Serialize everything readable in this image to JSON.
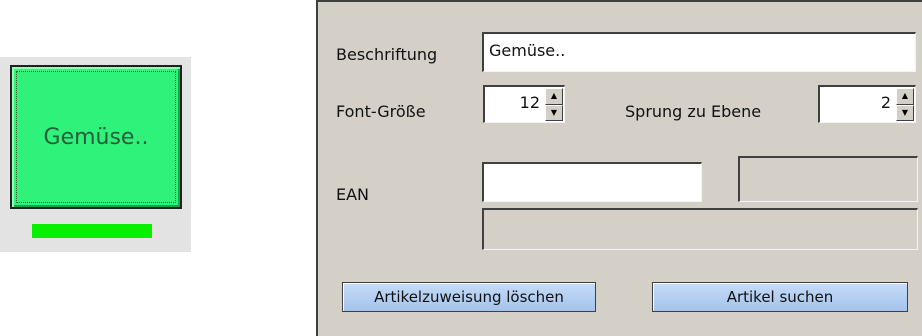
{
  "preview": {
    "button_label": "Gemüse..",
    "button_color": "#2ef27a",
    "indicator_color": "#08f000"
  },
  "panel": {
    "beschriftung_label": "Beschriftung",
    "beschriftung_value": "Gemüse..",
    "font_size_label": "Font-Größe",
    "font_size_value": "12",
    "jump_label": "Sprung zu Ebene",
    "jump_value": "2",
    "ean_label": "EAN",
    "ean_value": "",
    "ean_aux_value": "",
    "article_name_value": "",
    "clear_button": "Artikelzuweisung löschen",
    "search_button": "Artikel suchen"
  },
  "icons": {
    "spin_up": "arrow-up-icon",
    "spin_down": "arrow-down-icon"
  }
}
